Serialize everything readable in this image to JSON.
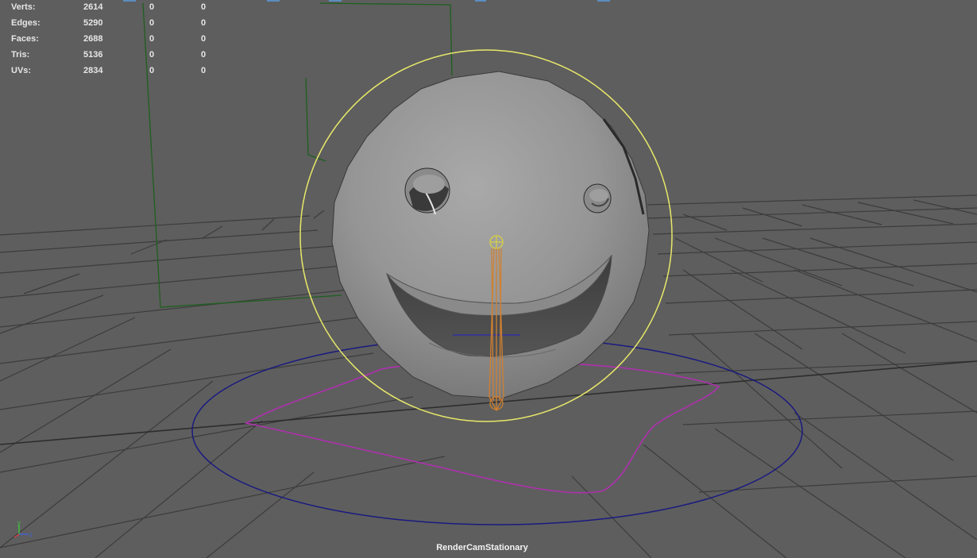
{
  "hud": {
    "rows": [
      {
        "label": "Verts:",
        "values": [
          "2614",
          "0",
          "0"
        ]
      },
      {
        "label": "Edges:",
        "values": [
          "5290",
          "0",
          "0"
        ]
      },
      {
        "label": "Faces:",
        "values": [
          "2688",
          "0",
          "0"
        ]
      },
      {
        "label": "Tris:",
        "values": [
          "5136",
          "0",
          "0"
        ]
      },
      {
        "label": "UVs:",
        "values": [
          "2834",
          "0",
          "0"
        ]
      }
    ]
  },
  "camera": {
    "name": "RenderCamStationary"
  },
  "axis_gizmo": {
    "labels": [
      "y",
      "z"
    ]
  },
  "colors": {
    "background": "#5e5e5e",
    "grid": "#383838",
    "grid_axis": "#2a2a2a",
    "selection_circle": "#e8e86a",
    "ground_circle": "#1a1a80",
    "curve": "#b030b0",
    "camera_frame": "#1f5f1f",
    "joint": "#d08030",
    "mesh": "#9a9a9a"
  }
}
